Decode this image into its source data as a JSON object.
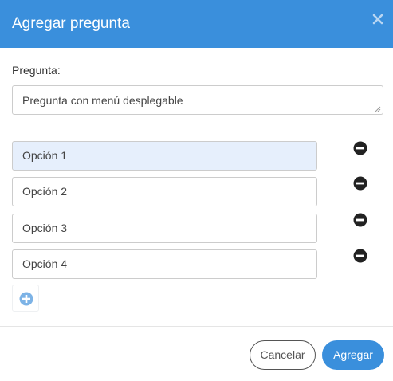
{
  "dialog": {
    "title": "Agregar pregunta",
    "close_icon": "close-icon"
  },
  "question": {
    "label": "Pregunta:",
    "value": "Pregunta con menú desplegable"
  },
  "options": [
    {
      "value": "Opción 1",
      "selected": true
    },
    {
      "value": "Opción 2",
      "selected": false
    },
    {
      "value": "Opción 3",
      "selected": false
    },
    {
      "value": "Opción 4",
      "selected": false
    }
  ],
  "icons": {
    "remove": "minus-circle-icon",
    "add": "plus-circle-icon"
  },
  "footer": {
    "cancel_label": "Cancelar",
    "submit_label": "Agregar"
  },
  "colors": {
    "accent": "#3a8fdc",
    "selected_option": "#e6effc",
    "add_icon": "#7db3e6",
    "remove_icon": "#222222"
  }
}
